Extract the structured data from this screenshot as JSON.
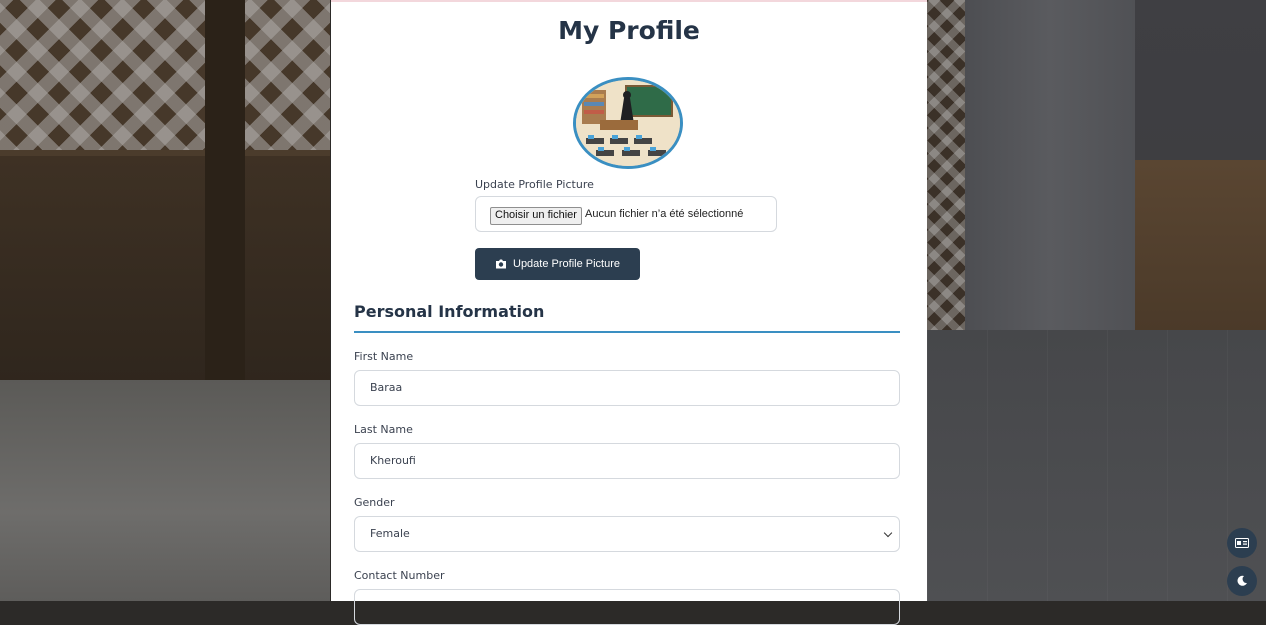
{
  "page_title": "My Profile",
  "profile_picture": {
    "label": "Update Profile Picture",
    "file_button": "Choisir un fichier",
    "file_status": "Aucun fichier n’a été sélectionné",
    "update_button": "Update Profile Picture",
    "button_icon": "camera-icon"
  },
  "personal_info": {
    "title": "Personal Information",
    "fields": [
      {
        "label": "First Name",
        "value": "Baraa"
      },
      {
        "label": "Last Name",
        "value": "Kheroufi"
      },
      {
        "label": "Gender",
        "value": "Female"
      },
      {
        "label": "Contact Number"
      }
    ]
  },
  "floating_buttons": [
    "accessibility-icon",
    "dark-mode-moon-icon"
  ],
  "colors": {
    "primary": "#2c3e50",
    "accent": "#3a8fc2",
    "title": "#253447"
  }
}
